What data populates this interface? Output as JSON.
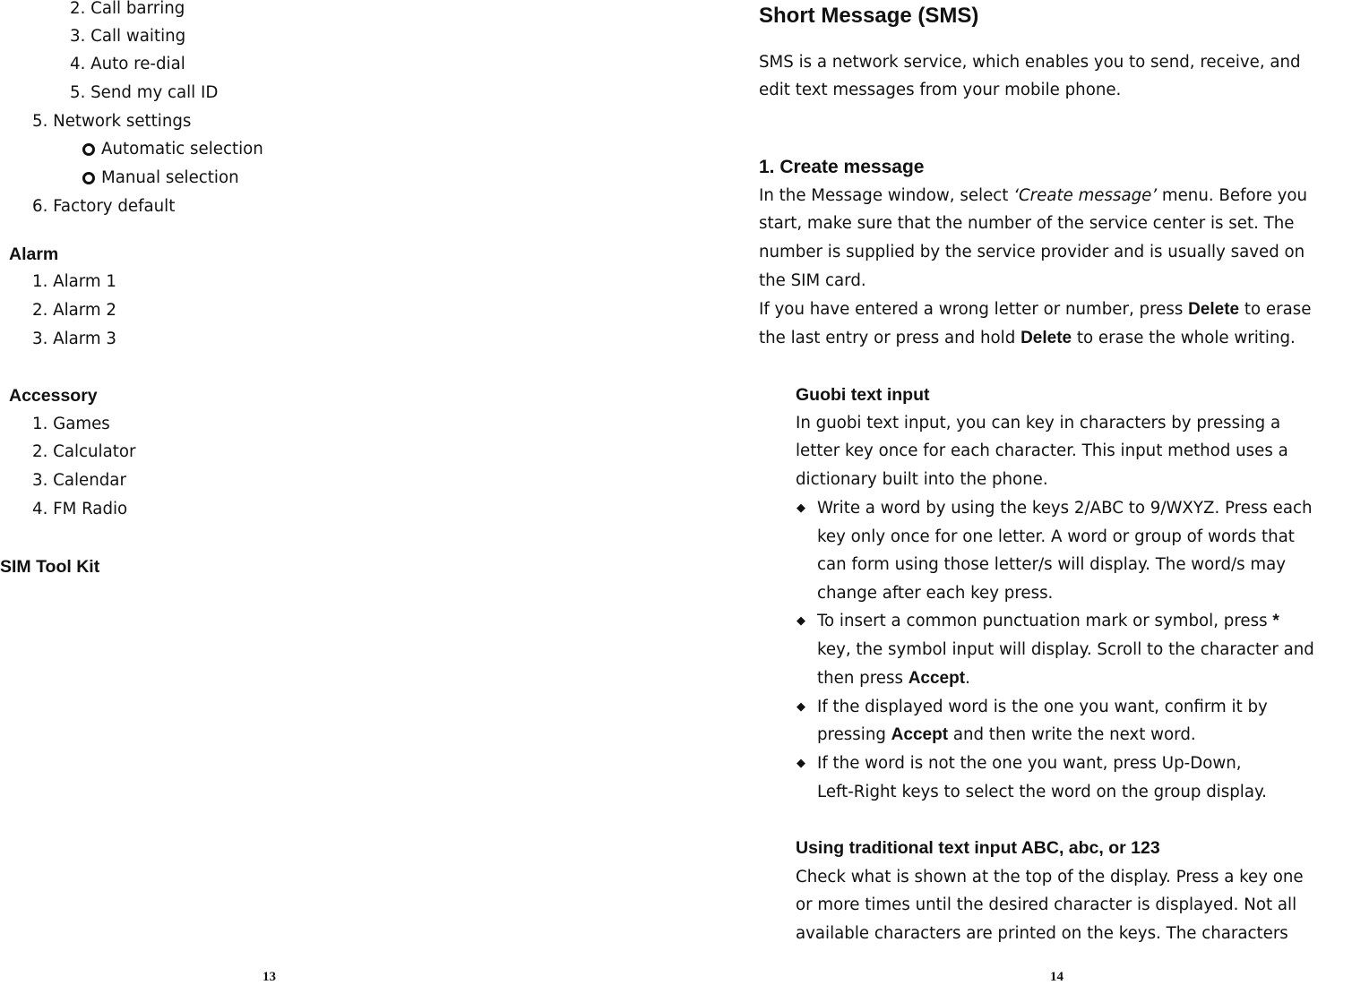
{
  "left_page": {
    "page_number": "13",
    "lines": [
      {
        "kind": "sub",
        "segments": [
          {
            "text": "2. Call barring"
          }
        ]
      },
      {
        "kind": "sub",
        "segments": [
          {
            "text": "3. Call waiting"
          }
        ]
      },
      {
        "kind": "sub",
        "segments": [
          {
            "text": "4. Auto re-dial"
          }
        ]
      },
      {
        "kind": "sub",
        "segments": [
          {
            "text": "5. Send my call ID"
          }
        ]
      },
      {
        "kind": "item",
        "segments": [
          {
            "text": "5. Network settings"
          }
        ]
      },
      {
        "kind": "circle-bullet",
        "segments": [
          {
            "text": "Automatic selection"
          }
        ]
      },
      {
        "kind": "circle-bullet",
        "segments": [
          {
            "text": "Manual selection"
          }
        ]
      },
      {
        "kind": "item",
        "segments": [
          {
            "text": "6. Factory default"
          }
        ]
      },
      {
        "kind": "heading",
        "segments": [
          {
            "text": "Alarm"
          }
        ]
      },
      {
        "kind": "item",
        "segments": [
          {
            "text": "1. Alarm 1"
          }
        ]
      },
      {
        "kind": "item",
        "segments": [
          {
            "text": "2. Alarm 2"
          }
        ]
      },
      {
        "kind": "item",
        "segments": [
          {
            "text": "3. Alarm 3"
          }
        ]
      },
      {
        "kind": "heading",
        "segments": [
          {
            "text": "Accessory"
          }
        ]
      },
      {
        "kind": "item",
        "segments": [
          {
            "text": "1. Games"
          }
        ]
      },
      {
        "kind": "item",
        "segments": [
          {
            "text": "2. Calculator"
          }
        ]
      },
      {
        "kind": "item",
        "segments": [
          {
            "text": "3. Calendar"
          }
        ]
      },
      {
        "kind": "item",
        "segments": [
          {
            "text": "4. FM Radio"
          }
        ]
      },
      {
        "kind": "top-heading",
        "segments": [
          {
            "text": "SIM Tool Kit"
          }
        ]
      }
    ]
  },
  "right_page": {
    "page_number": "14",
    "lines": [
      {
        "kind": "title",
        "segments": [
          {
            "text": "Short Message (SMS)"
          }
        ]
      },
      {
        "kind": "body",
        "segments": [
          {
            "text": "SMS is a network service, which enables you to send, receive, and"
          }
        ]
      },
      {
        "kind": "body",
        "segments": [
          {
            "text": "edit text messages from your mobile phone."
          }
        ]
      },
      {
        "kind": "section",
        "segments": [
          {
            "text": "1. Create message"
          }
        ]
      },
      {
        "kind": "body",
        "segments": [
          {
            "text": "In the Message window, select "
          },
          {
            "text": "‘Create message’",
            "emphasis": "italic"
          },
          {
            "text": " menu. Before you"
          }
        ]
      },
      {
        "kind": "body",
        "segments": [
          {
            "text": "start, make sure that the number of the service center is set. The"
          }
        ]
      },
      {
        "kind": "body",
        "segments": [
          {
            "text": "number is supplied by the service provider and is usually saved on"
          }
        ]
      },
      {
        "kind": "body",
        "segments": [
          {
            "text": "the SIM card."
          }
        ]
      },
      {
        "kind": "body",
        "segments": [
          {
            "text": "If you have entered a wrong letter or number, press "
          },
          {
            "text": "Delete",
            "emphasis": "bold"
          },
          {
            "text": " to erase"
          }
        ]
      },
      {
        "kind": "body",
        "segments": [
          {
            "text": "the last entry or press and hold "
          },
          {
            "text": "Delete",
            "emphasis": "bold"
          },
          {
            "text": " to erase the whole writing."
          }
        ]
      },
      {
        "kind": "subsection",
        "segments": [
          {
            "text": "Guobi text input"
          }
        ]
      },
      {
        "kind": "indent",
        "segments": [
          {
            "text": "In guobi text input, you can key in characters by pressing a"
          }
        ]
      },
      {
        "kind": "indent",
        "segments": [
          {
            "text": "letter key once for each character. This input method uses a"
          }
        ]
      },
      {
        "kind": "indent",
        "segments": [
          {
            "text": "dictionary built into the phone."
          }
        ]
      },
      {
        "kind": "diamond-bullet",
        "segments": [
          {
            "text": "Write a word by using the keys 2/ABC to 9/WXYZ. Press each"
          }
        ]
      },
      {
        "kind": "bullet-cont",
        "segments": [
          {
            "text": "key only once for one letter. A word or group of words that"
          }
        ]
      },
      {
        "kind": "bullet-cont",
        "segments": [
          {
            "text": "can form using those letter/s will display. The word/s may"
          }
        ]
      },
      {
        "kind": "bullet-cont",
        "segments": [
          {
            "text": "change after each key press."
          }
        ]
      },
      {
        "kind": "diamond-bullet",
        "segments": [
          {
            "text": "To insert a common punctuation mark or symbol, press "
          },
          {
            "text": "*",
            "emphasis": "bold"
          }
        ]
      },
      {
        "kind": "bullet-cont",
        "segments": [
          {
            "text": "key, the symbol input will display. Scroll to the character and"
          }
        ]
      },
      {
        "kind": "bullet-cont",
        "segments": [
          {
            "text": "then press "
          },
          {
            "text": "Accept",
            "emphasis": "bold"
          },
          {
            "text": "."
          }
        ]
      },
      {
        "kind": "diamond-bullet",
        "segments": [
          {
            "text": "If the displayed word is the one you want, confirm it by"
          }
        ]
      },
      {
        "kind": "bullet-cont",
        "segments": [
          {
            "text": "pressing "
          },
          {
            "text": "Accept",
            "emphasis": "bold"
          },
          {
            "text": " and then write the next word."
          }
        ]
      },
      {
        "kind": "diamond-bullet",
        "segments": [
          {
            "text": "If the word is not the one you want, press Up-Down,"
          }
        ]
      },
      {
        "kind": "bullet-cont",
        "segments": [
          {
            "text": "Left-Right keys to select the word on the group display."
          }
        ]
      },
      {
        "kind": "subsection",
        "segments": [
          {
            "text": "Using traditional text input ABC, abc, or 123"
          }
        ]
      },
      {
        "kind": "indent",
        "segments": [
          {
            "text": "Check what is shown at the top of the display. Press a key one"
          }
        ]
      },
      {
        "kind": "indent",
        "segments": [
          {
            "text": "or more times until the desired character is displayed. Not all"
          }
        ]
      },
      {
        "kind": "indent",
        "segments": [
          {
            "text": "available characters are printed on the keys. The characters"
          }
        ]
      }
    ]
  }
}
